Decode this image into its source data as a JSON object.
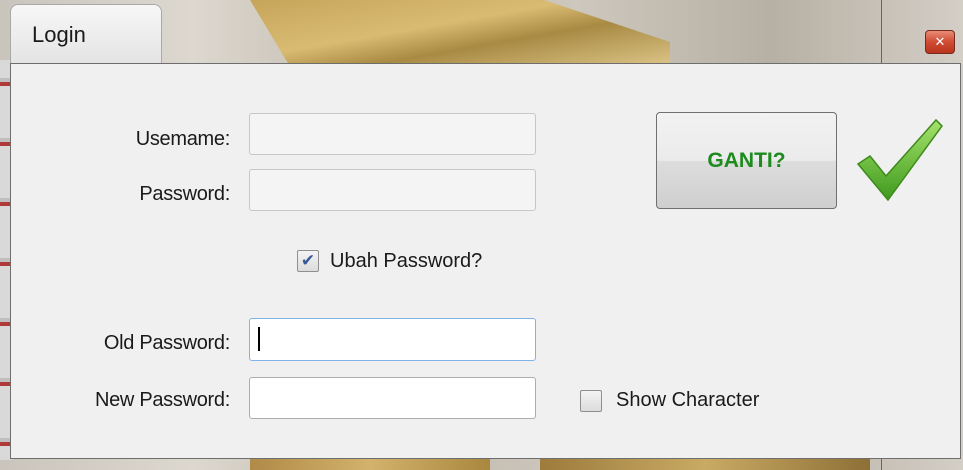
{
  "window": {
    "title": "Login",
    "close_glyph": "✕"
  },
  "form": {
    "username_label": "Usemame:",
    "password_label": "Password:",
    "username_value": "",
    "password_value": "",
    "change_password_checkbox": {
      "label": "Ubah Password?",
      "checked": true
    },
    "old_password_label": "Old Password:",
    "new_password_label": "New Password:",
    "old_password_value": "",
    "new_password_value": "",
    "show_character_checkbox": {
      "label": "Show Character",
      "checked": false
    }
  },
  "actions": {
    "ganti_label": "GANTI?",
    "check_icon": "green-checkmark-icon"
  },
  "colors": {
    "ganti_text": "#1e8b1e",
    "checkmark": "#5cb82e",
    "close_button": "#cf4b32"
  }
}
